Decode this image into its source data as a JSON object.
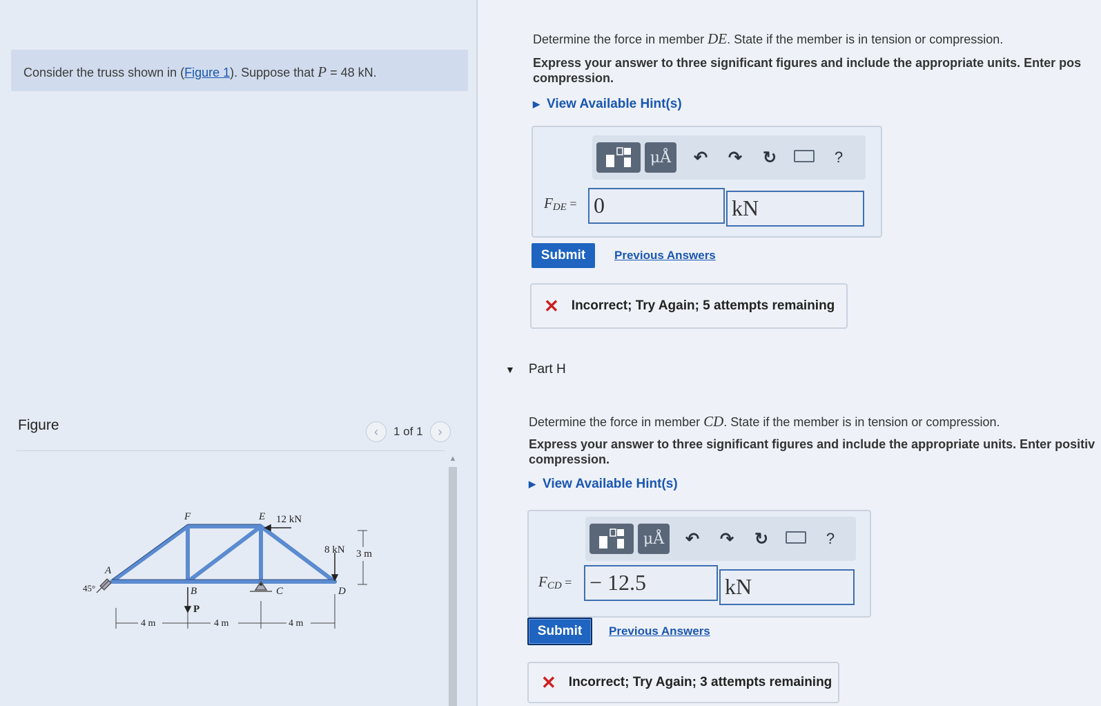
{
  "problem": {
    "text_before": "Consider the truss shown in (",
    "figure_link": "Figure 1",
    "text_middle": "). Suppose that ",
    "var": "P",
    "text_after": " = 48 kN."
  },
  "figure": {
    "heading": "Figure",
    "pager_text": "1 of 1",
    "prev_icon": "chevron-left-icon",
    "next_icon": "chevron-right-icon",
    "labels": {
      "A": "A",
      "B": "B",
      "C": "C",
      "D": "D",
      "E": "E",
      "F": "F",
      "load_e": "12 kN",
      "load_d": "8 kN",
      "load_p": "P",
      "angle": "45°",
      "height": "3 m",
      "span1": "4 m",
      "span2": "4 m",
      "span3": "4 m"
    }
  },
  "part_g": {
    "question_before": "Determine the force in member ",
    "member": "DE",
    "question_after": ". State if the member is in tension or compression.",
    "instr_line1": "Express your answer to three significant figures and include the appropriate units. Enter pos",
    "instr_line2": "compression.",
    "hint_label": "View Available Hint(s)",
    "toolbar": {
      "templates_icon": "templates-icon",
      "units_label": "μÅ",
      "undo_icon": "undo-icon",
      "redo_icon": "redo-icon",
      "reset_icon": "reset-icon",
      "keyboard_icon": "keyboard-icon",
      "help_label": "?"
    },
    "answer_label_main": "F",
    "answer_label_sub": "DE",
    "answer_eq": " =",
    "answer_value": "0",
    "unit_value": "kN",
    "submit_label": "Submit",
    "previous_answers": "Previous Answers",
    "feedback": "Incorrect; Try Again; 5 attempts remaining"
  },
  "part_h": {
    "title": "Part H",
    "question_before": "Determine the force in member ",
    "member": "CD",
    "question_after": ". State if the member is in tension or compression.",
    "instr_line1": "Express your answer to three significant figures and include the appropriate units. Enter positiv",
    "instr_line2": "compression.",
    "hint_label": "View Available Hint(s)",
    "toolbar": {
      "units_label": "μÅ",
      "help_label": "?"
    },
    "answer_label_main": "F",
    "answer_label_sub": "CD",
    "answer_eq": " =",
    "answer_value": "− 12.5",
    "unit_value": "kN",
    "submit_label": "Submit",
    "previous_answers": "Previous Answers",
    "feedback": "Incorrect; Try Again; 3 attempts remaining"
  },
  "colors": {
    "accent": "#1e64c0",
    "error": "#cc1f1f",
    "truss_member": "#5b8bd0"
  }
}
